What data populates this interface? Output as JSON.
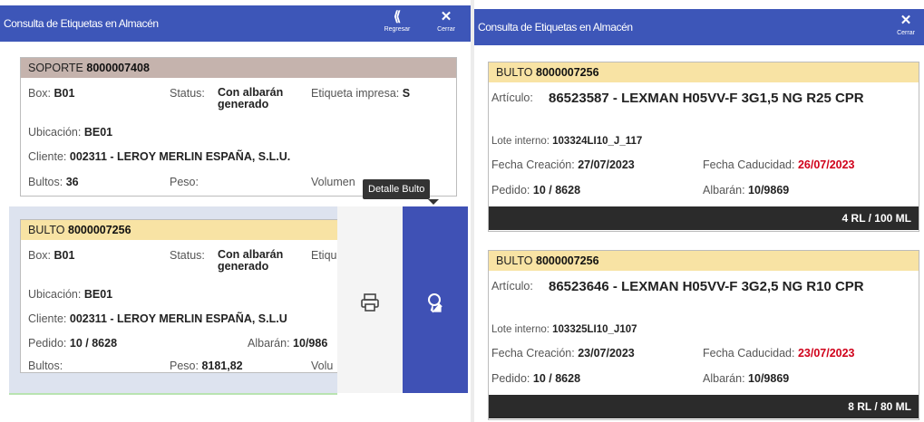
{
  "left": {
    "header": {
      "title": "Consulta de Etiquetas en Almacén",
      "back_label": "Regresar",
      "close_label": "Cerrar",
      "back_icon": "⟪",
      "close_icon": "✕"
    },
    "soporte": {
      "header_label": "SOPORTE",
      "header_id": "8000007408",
      "box_label": "Box:",
      "box_value": "B01",
      "status_label": "Status:",
      "status_value": "Con albarán generado",
      "etiqueta_label": "Etiqueta impresa:",
      "etiqueta_value": "S",
      "ubicacion_label": "Ubicación:",
      "ubicacion_value": "BE01",
      "cliente_label": "Cliente:",
      "cliente_value": "002311 - LEROY MERLIN ESPAÑA, S.L.U.",
      "bultos_label": "Bultos:",
      "bultos_value": "36",
      "peso_label": "Peso:",
      "volumen_label": "Volumen"
    },
    "tooltip": "Detalle Bulto",
    "bulto": {
      "header_label": "BULTO",
      "header_id": "8000007256",
      "box_label": "Box:",
      "box_value": "B01",
      "status_label": "Status:",
      "status_value": "Con albarán generado",
      "etiq_cut": "Etiqu",
      "ubicacion_label": "Ubicación:",
      "ubicacion_value": "BE01",
      "cliente_label": "Cliente:",
      "cliente_value": "002311 - LEROY MERLIN ESPAÑA, S.L.U",
      "pedido_label": "Pedido:",
      "pedido_value": "10 / 8628",
      "albaran_label": "Albarán:",
      "albaran_value": "10/986",
      "bultos_label": "Bultos:",
      "peso_label": "Peso:",
      "peso_value": "8181,82",
      "volu_cut": "Volu"
    },
    "colors": {
      "header_blue": "#3d56b8",
      "soporte_head": "#c5b3ad",
      "bulto_head": "#f8e3a4",
      "swipe_blue": "#3f51b5"
    }
  },
  "right": {
    "header": {
      "title": "Consulta de Etiquetas en Almacén",
      "close_label": "Cerrar",
      "close_icon": "✕"
    },
    "cards": [
      {
        "header_label": "BULTO",
        "header_id": "8000007256",
        "articulo_label": "Artículo:",
        "articulo_value": "86523587 - LEXMAN H05VV-F 3G1,5 NG R25 CPR",
        "lote_label": "Lote interno:",
        "lote_value": "103324LI10_J_117",
        "fcrea_label": "Fecha Creación:",
        "fcrea_value": "27/07/2023",
        "fcad_label": "Fecha Caducidad:",
        "fcad_value": "26/07/2023",
        "pedido_label": "Pedido:",
        "pedido_value": "10 / 8628",
        "albaran_label": "Albarán:",
        "albaran_value": "10/9869",
        "qty": "4 RL / 100 ML"
      },
      {
        "header_label": "BULTO",
        "header_id": "8000007256",
        "articulo_label": "Artículo:",
        "articulo_value": "86523646 - LEXMAN H05VV-F 3G2,5 NG R10 CPR",
        "lote_label": "Lote interno:",
        "lote_value": "103325LI10_J107",
        "fcrea_label": "Fecha Creación:",
        "fcrea_value": "23/07/2023",
        "fcad_label": "Fecha Caducidad:",
        "fcad_value": "23/07/2023",
        "pedido_label": "Pedido:",
        "pedido_value": "10 / 8628",
        "albaran_label": "Albarán:",
        "albaran_value": "10/9869",
        "qty": "8 RL / 80 ML"
      }
    ]
  }
}
